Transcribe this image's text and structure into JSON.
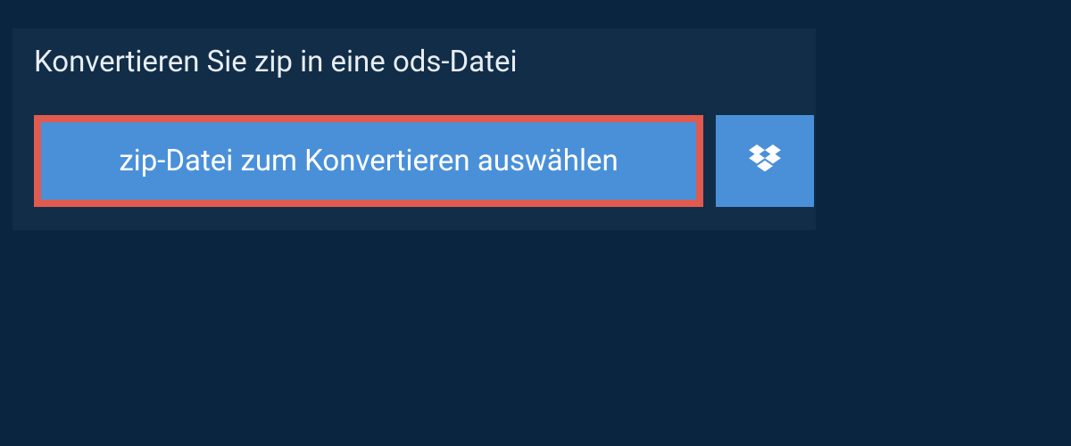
{
  "header": {
    "title": "Konvertieren Sie zip in eine ods-Datei"
  },
  "actions": {
    "select_file_label": "zip-Datei zum Konvertieren auswählen",
    "dropbox_icon": "dropbox-icon"
  },
  "colors": {
    "page_bg": "#0a2540",
    "panel_bg": "#122d47",
    "button_bg": "#4a90d9",
    "button_border": "#e05a4f",
    "text_light": "#e8eef4",
    "text_white": "#ffffff"
  }
}
